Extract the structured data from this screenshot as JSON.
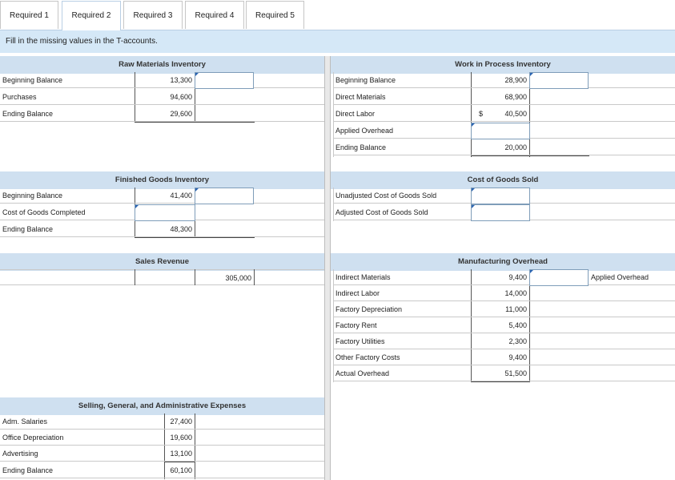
{
  "tabs": [
    "Required 1",
    "Required 2",
    "Required 3",
    "Required 4",
    "Required 5"
  ],
  "instruction": "Fill in the missing values in the T-accounts.",
  "rm": {
    "title": "Raw Materials Inventory",
    "rows": [
      {
        "label": "Beginning Balance",
        "value": "13,300"
      },
      {
        "label": "Purchases",
        "value": "94,600"
      },
      {
        "label": "Ending Balance",
        "value": "29,600"
      }
    ]
  },
  "wip": {
    "title": "Work in Process Inventory",
    "rows": [
      {
        "label": "Beginning Balance",
        "value": "28,900"
      },
      {
        "label": "Direct Materials",
        "value": "68,900"
      },
      {
        "label": "Direct Labor",
        "prefix": "$",
        "value": "40,500"
      },
      {
        "label": "Applied Overhead",
        "value": ""
      },
      {
        "label": "Ending Balance",
        "value": "20,000"
      }
    ]
  },
  "fg": {
    "title": "Finished Goods Inventory",
    "rows": [
      {
        "label": "Beginning Balance",
        "value": "41,400"
      },
      {
        "label": "Cost of Goods Completed",
        "value": ""
      },
      {
        "label": "Ending Balance",
        "value": "48,300"
      }
    ]
  },
  "cogs": {
    "title": "Cost of Goods Sold",
    "rows": [
      {
        "label": "Unadjusted Cost of Goods Sold"
      },
      {
        "label": "Adjusted Cost of Goods Sold"
      }
    ]
  },
  "sales": {
    "title": "Sales Revenue",
    "credit": "305,000"
  },
  "moh": {
    "title": "Manufacturing Overhead",
    "credit_label": "Applied Overhead",
    "rows": [
      {
        "label": "Indirect Materials",
        "value": "9,400"
      },
      {
        "label": "Indirect Labor",
        "value": "14,000"
      },
      {
        "label": "Factory Depreciation",
        "value": "11,000"
      },
      {
        "label": "Factory Rent",
        "value": "5,400"
      },
      {
        "label": "Factory Utilities",
        "value": "2,300"
      },
      {
        "label": "Other Factory Costs",
        "value": "9,400"
      },
      {
        "label": "Actual Overhead",
        "value": "51,500"
      }
    ]
  },
  "sga": {
    "title": "Selling, General, and Administrative Expenses",
    "rows": [
      {
        "label": "Adm. Salaries",
        "value": "27,400"
      },
      {
        "label": "Office Depreciation",
        "value": "19,600"
      },
      {
        "label": "Advertising",
        "value": "13,100"
      },
      {
        "label": "Ending Balance",
        "value": "60,100"
      }
    ]
  }
}
